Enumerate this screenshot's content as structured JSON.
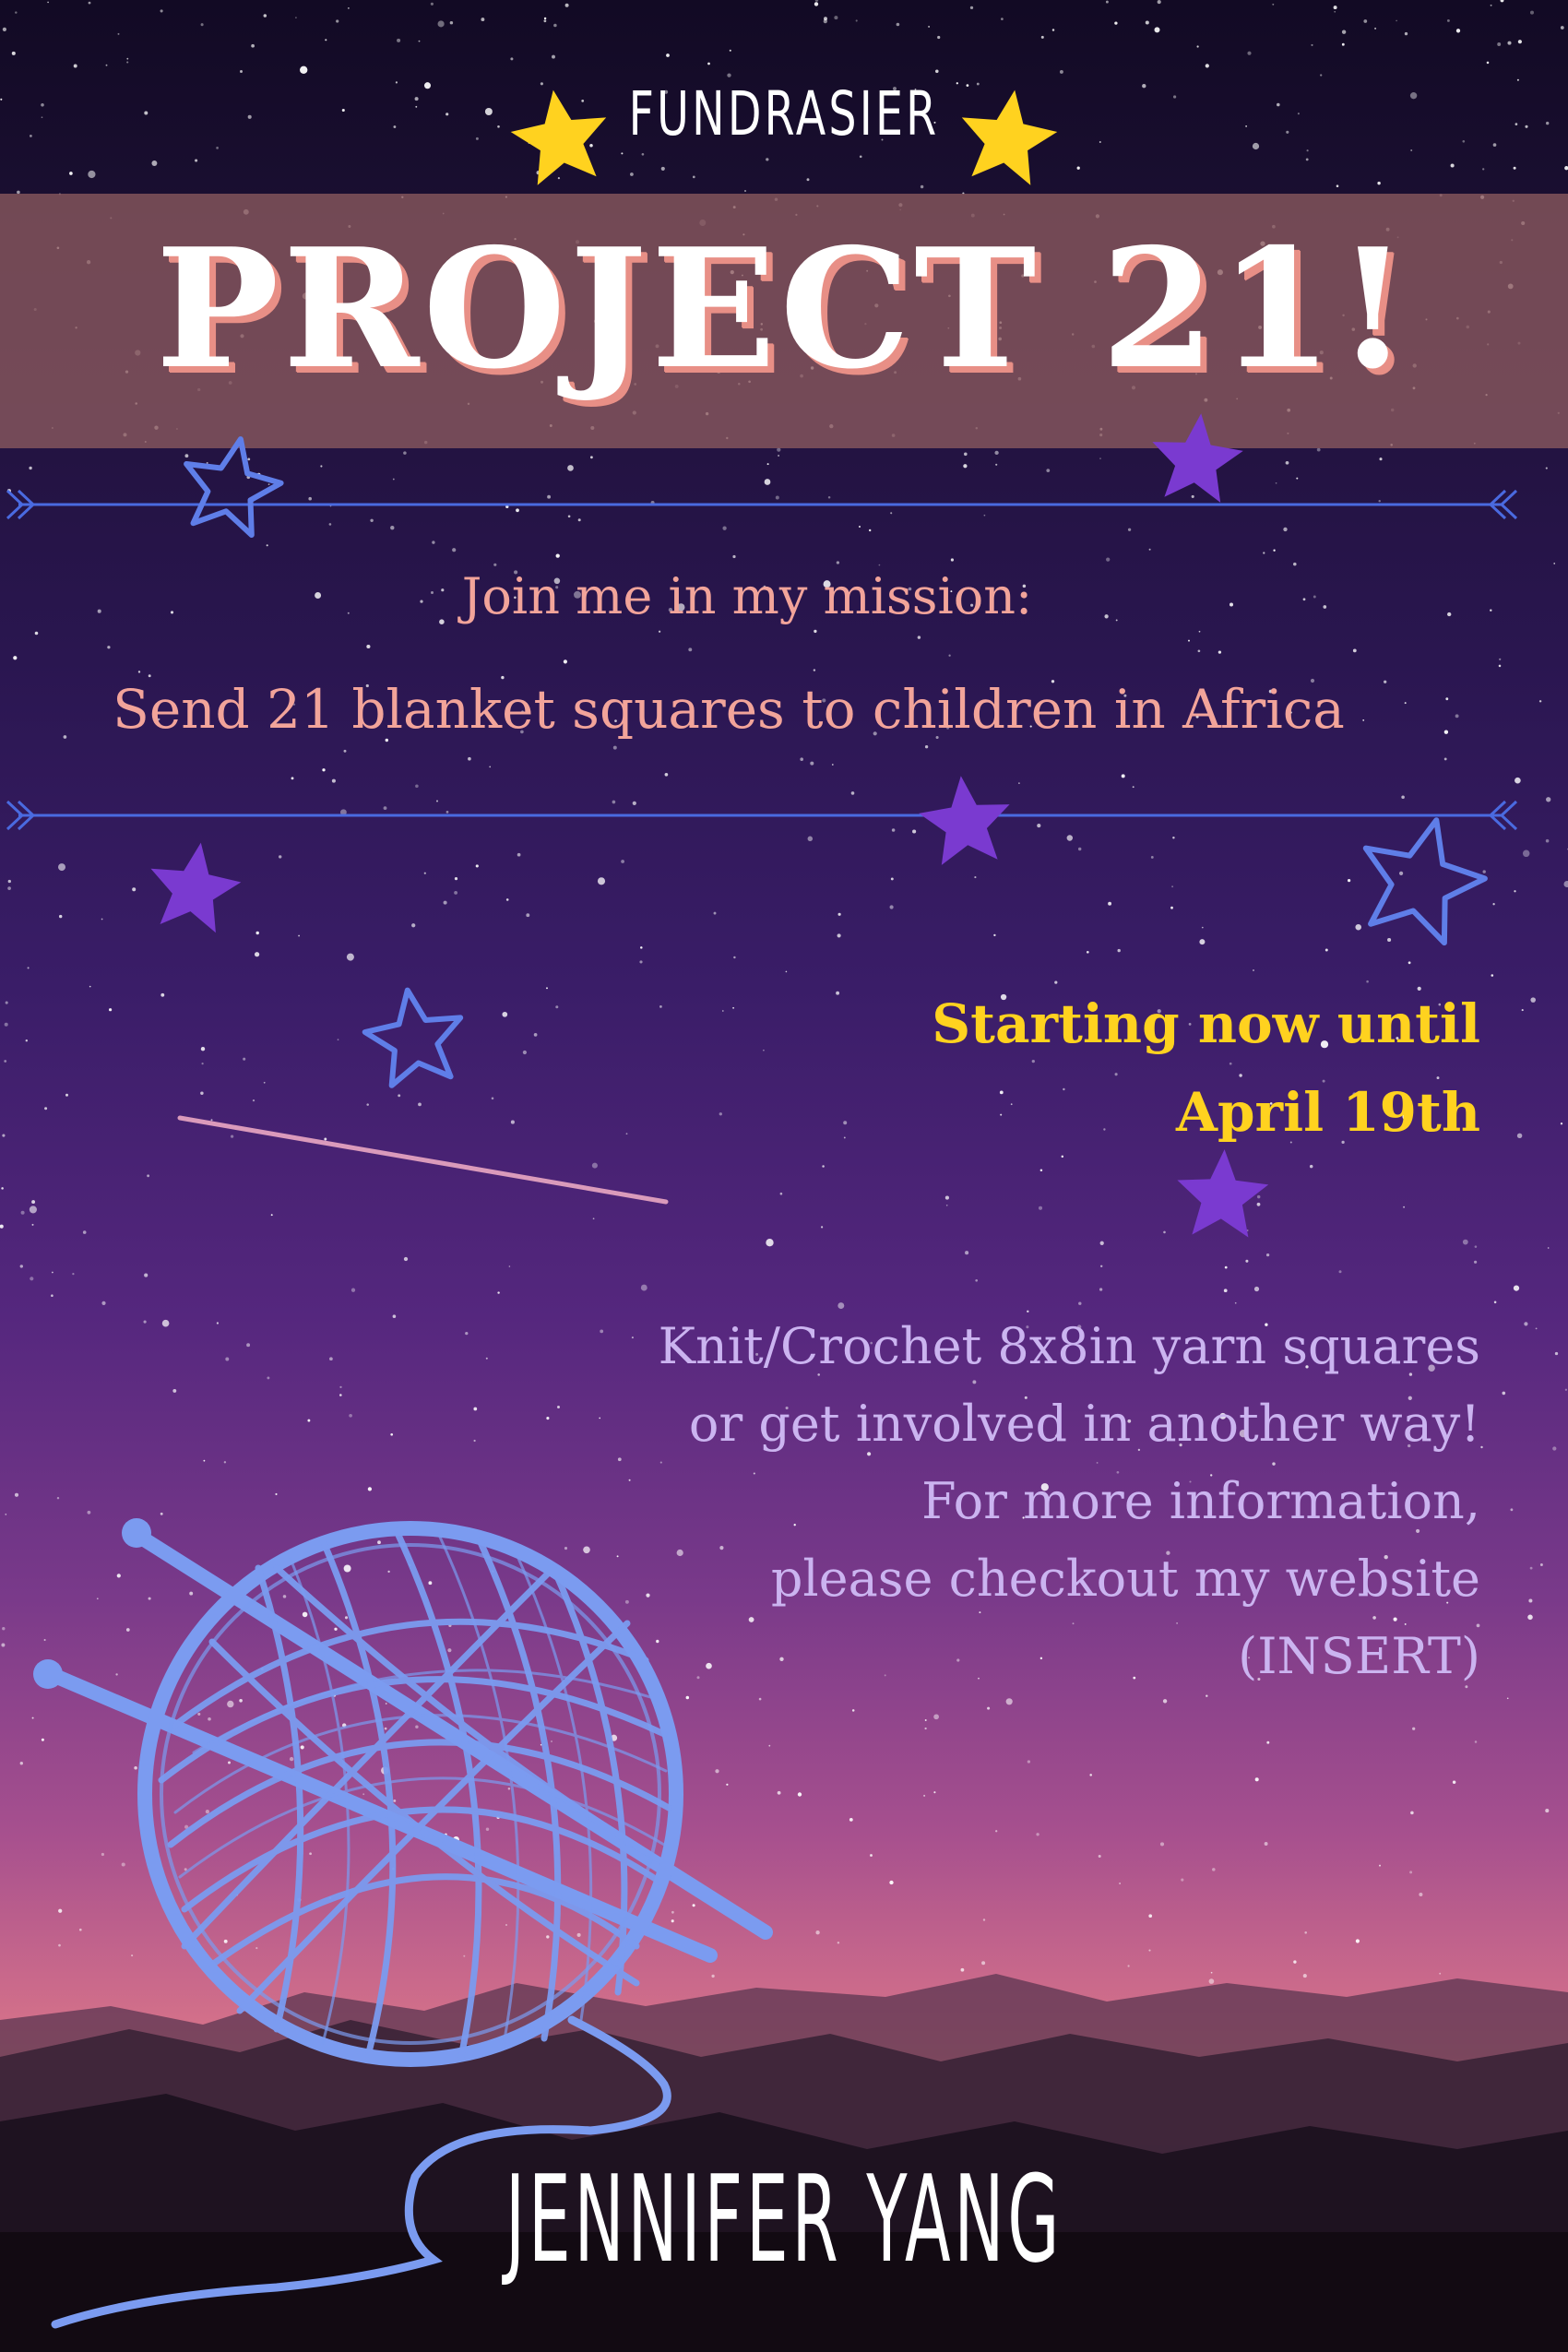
{
  "header": {
    "label": "FUNDRASIER",
    "title": "PROJECT 21!"
  },
  "mission": {
    "line1": "Join me in my mission:",
    "line2": "Send 21 blanket squares to children in Africa"
  },
  "dates": {
    "line1": "Starting now until",
    "line2": "April 19th"
  },
  "info": {
    "lines": [
      "Knit/Crochet 8x8in yarn squares",
      "or get involved in another way!",
      "For more information,",
      "please checkout my website",
      "(INSERT)"
    ]
  },
  "footer": {
    "name": "JENNIFER YANG"
  },
  "colors": {
    "title_shadow": "#e88f86",
    "mission_text": "#f2a49a",
    "dates_text": "#ffd21f",
    "info_text": "#cbb4f0",
    "yarn": "#7b9bf0",
    "star_yellow": "#ffd21f",
    "star_purple": "#7a3ad0",
    "star_outline": "#5f7ee8"
  },
  "icons": [
    "star-icon",
    "yarn-ball-icon",
    "knitting-needle-icon",
    "shooting-star-icon"
  ]
}
